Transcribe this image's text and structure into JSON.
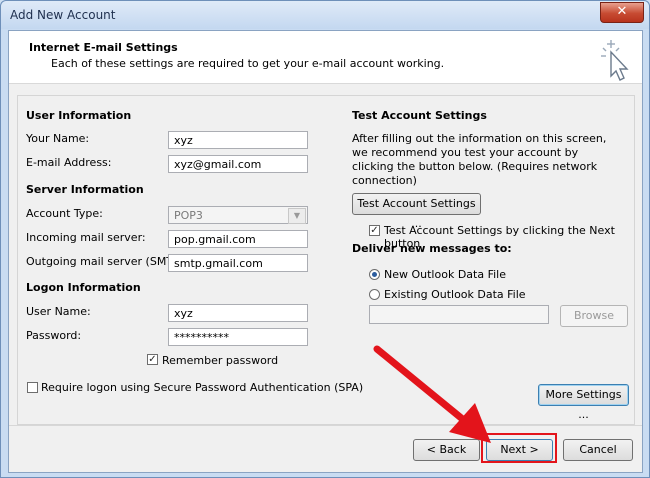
{
  "window": {
    "title": "Add New Account",
    "close_label": "✕"
  },
  "header": {
    "title": "Internet E-mail Settings",
    "subtitle": "Each of these settings are required to get your e-mail account working."
  },
  "user_info": {
    "heading": "User Information",
    "your_name_label": "Your Name:",
    "your_name_value": "xyz",
    "email_label": "E-mail Address:",
    "email_value": "xyz@gmail.com"
  },
  "server_info": {
    "heading": "Server Information",
    "account_type_label": "Account Type:",
    "account_type_value": "POP3",
    "incoming_label": "Incoming mail server:",
    "incoming_value": "pop.gmail.com",
    "outgoing_label": "Outgoing mail server (SMTP):",
    "outgoing_value": "smtp.gmail.com"
  },
  "logon_info": {
    "heading": "Logon Information",
    "user_name_label": "User Name:",
    "user_name_value": "xyz",
    "password_label": "Password:",
    "password_value": "**********",
    "remember_label": "Remember password",
    "remember_checked": true,
    "spa_label": "Require logon using Secure Password Authentication (SPA)",
    "spa_checked": false
  },
  "test_settings": {
    "heading": "Test Account Settings",
    "description": "After filling out the information on this screen, we recommend you test your account by clicking the button below. (Requires network connection)",
    "test_button": "Test Account Settings ...",
    "auto_test_label": "Test Account Settings by clicking the Next button",
    "auto_test_checked": true
  },
  "deliver": {
    "heading": "Deliver new messages to:",
    "new_file_label": "New Outlook Data File",
    "existing_file_label": "Existing Outlook Data File",
    "path_value": "",
    "browse_label": "Browse",
    "selected": "new"
  },
  "buttons": {
    "more_settings": "More Settings ...",
    "back": "< Back",
    "next": "Next >",
    "cancel": "Cancel"
  },
  "colors": {
    "highlight": "#e3141b",
    "selected_radio": "#2c5d9e"
  }
}
